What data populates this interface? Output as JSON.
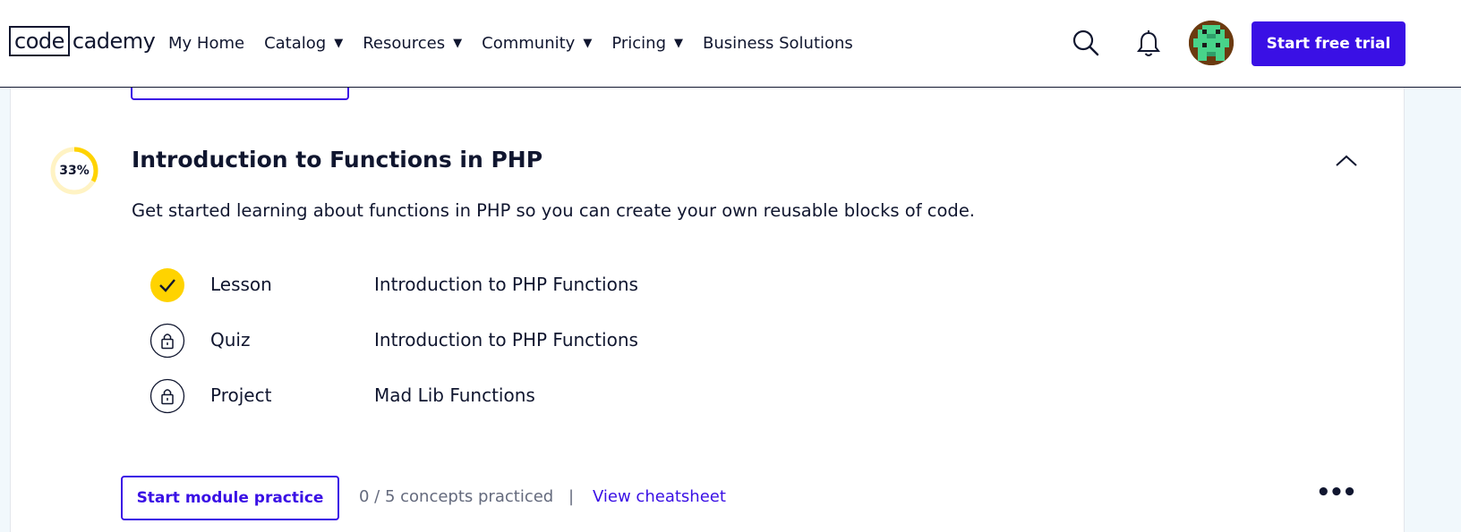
{
  "header": {
    "logo_code": "code",
    "logo_cademy": "cademy",
    "nav": [
      {
        "label": "My Home",
        "has_dropdown": false
      },
      {
        "label": "Catalog",
        "has_dropdown": true
      },
      {
        "label": "Resources",
        "has_dropdown": true
      },
      {
        "label": "Community",
        "has_dropdown": true
      },
      {
        "label": "Pricing",
        "has_dropdown": true
      },
      {
        "label": "Business Solutions",
        "has_dropdown": false
      }
    ],
    "caret": "▼",
    "search_icon": "search-icon",
    "bell_icon": "bell-icon",
    "cta_label": "Start free trial"
  },
  "module": {
    "progress_label": "33%",
    "progress_fraction": 0.33,
    "title": "Introduction to Functions in PHP",
    "description": "Get started learning about functions in PHP so you can create your own reusable blocks of code.",
    "items": [
      {
        "type": "Lesson",
        "name": "Introduction to PHP Functions",
        "status": "completed"
      },
      {
        "type": "Quiz",
        "name": "Introduction to PHP Functions",
        "status": "locked"
      },
      {
        "type": "Project",
        "name": "Mad Lib Functions",
        "status": "locked"
      }
    ],
    "practice_button": "Start module practice",
    "practice_stats": "0 / 5 concepts practiced",
    "divider": "|",
    "cheatsheet_link": "View cheatsheet",
    "more_label": "•••"
  },
  "colors": {
    "brand": "#3a10e5",
    "navy": "#10162f",
    "progress_yellow": "#ffd300",
    "progress_track": "#fff3c4",
    "muted_text": "#646a7d"
  }
}
